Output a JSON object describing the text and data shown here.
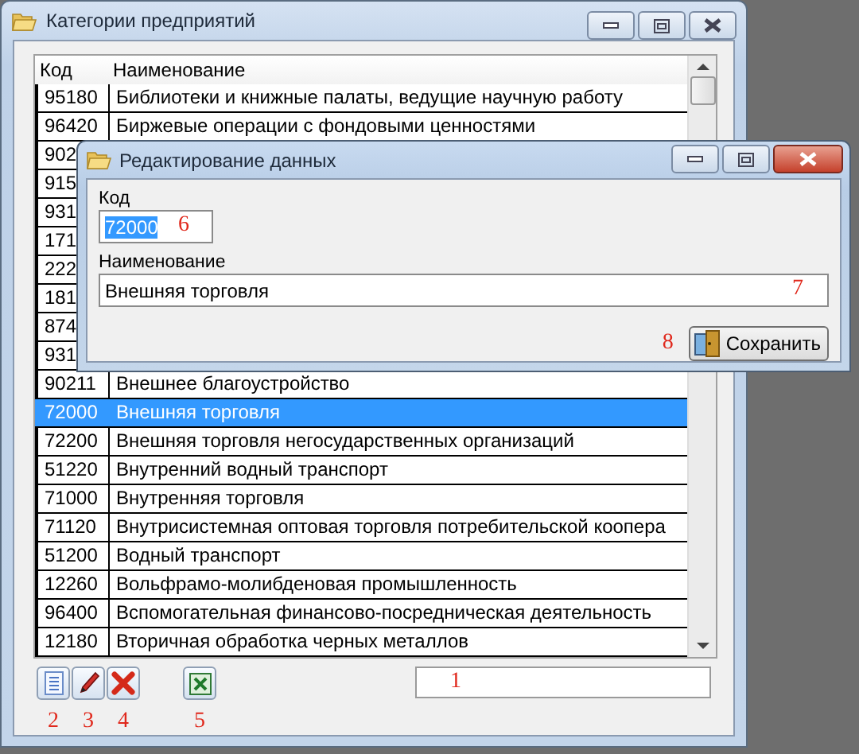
{
  "window": {
    "title": "Категории предприятий"
  },
  "table": {
    "columns": [
      "Код",
      "Наименование"
    ],
    "rows": [
      {
        "code": "95180",
        "name": "Библиотеки и книжные палаты, ведущие научную работу",
        "selected": false
      },
      {
        "code": "96420",
        "name": "Биржевые операции с фондовыми ценностями",
        "selected": false
      },
      {
        "code": "902",
        "selected": false
      },
      {
        "code": "915",
        "selected": false
      },
      {
        "code": "931",
        "selected": false
      },
      {
        "code": "171",
        "selected": false
      },
      {
        "code": "222",
        "selected": false
      },
      {
        "code": "181",
        "selected": false
      },
      {
        "code": "874",
        "selected": false
      },
      {
        "code": "931",
        "selected": false
      },
      {
        "code": "90211",
        "name": "Внешнее благоустройство",
        "selected": false
      },
      {
        "code": "72000",
        "name": "Внешняя торговля",
        "selected": true
      },
      {
        "code": "72200",
        "name": "Внешняя торговля негосударственных организаций",
        "selected": false
      },
      {
        "code": "51220",
        "name": "Внутренний водный транспорт",
        "selected": false
      },
      {
        "code": "71000",
        "name": "Внутренняя торговля",
        "selected": false
      },
      {
        "code": "71120",
        "name": "Внутрисистемная оптовая торговля потребительской коопера",
        "selected": false
      },
      {
        "code": "51200",
        "name": "Водный транспорт",
        "selected": false
      },
      {
        "code": "12260",
        "name": "Вольфрамо-молибденовая промышленность",
        "selected": false
      },
      {
        "code": "96400",
        "name": "Вспомогательная финансово-посредническая деятельность",
        "selected": false
      },
      {
        "code": "12180",
        "name": "Вторичная обработка черных металлов",
        "selected": false
      }
    ]
  },
  "toolbar": {
    "buttons": [
      {
        "kind": "add",
        "annotation": "2"
      },
      {
        "kind": "edit",
        "annotation": "3"
      },
      {
        "kind": "delete",
        "annotation": "4"
      },
      {
        "kind": "excel",
        "annotation": "5"
      }
    ],
    "search": {
      "annotation": "1"
    }
  },
  "dialog": {
    "title": "Редактирование данных",
    "fields": [
      {
        "label": "Код",
        "value": "72000",
        "text_selected": true,
        "annotation": "6"
      },
      {
        "label": "Наименование",
        "value": "Внешняя торговля",
        "text_selected": false,
        "annotation": "7"
      }
    ],
    "save_button": {
      "label": "Сохранить",
      "annotation": "8"
    }
  }
}
